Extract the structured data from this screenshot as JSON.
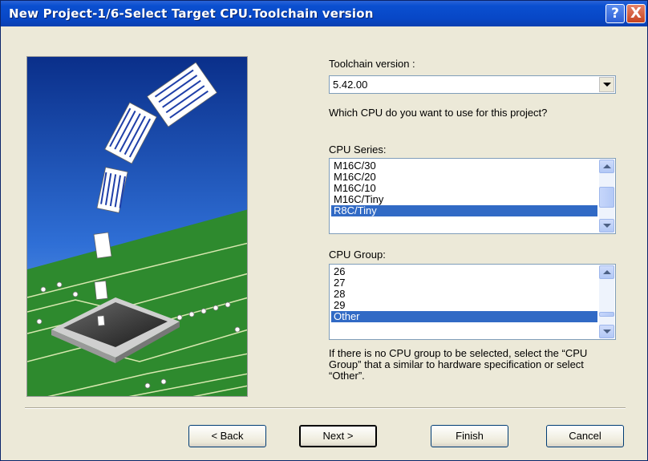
{
  "window": {
    "title": "New Project-1/6-Select Target CPU.Toolchain version",
    "help_label": "?",
    "close_label": "X"
  },
  "toolchain": {
    "label": "Toolchain version :",
    "value": "5.42.00"
  },
  "question": "Which CPU do you want to use for this project?",
  "cpu_series": {
    "label": "CPU Series:",
    "items": [
      "M16C/30",
      "M16C/20",
      "M16C/10",
      "M16C/Tiny",
      "R8C/Tiny"
    ],
    "selected": "R8C/Tiny"
  },
  "cpu_group": {
    "label": "CPU Group:",
    "items": [
      "26",
      "27",
      "28",
      "29",
      "Other"
    ],
    "selected": "Other"
  },
  "note": "If there is no CPU group to be selected, select the “CPU Group” that a similar to hardware specification or select “Other”.",
  "buttons": {
    "back": "< Back",
    "next": "Next >",
    "finish": "Finish",
    "cancel": "Cancel"
  },
  "colors": {
    "titlebar": "#0847c6",
    "selection": "#316ac5",
    "dialog_bg": "#ece9d8"
  }
}
